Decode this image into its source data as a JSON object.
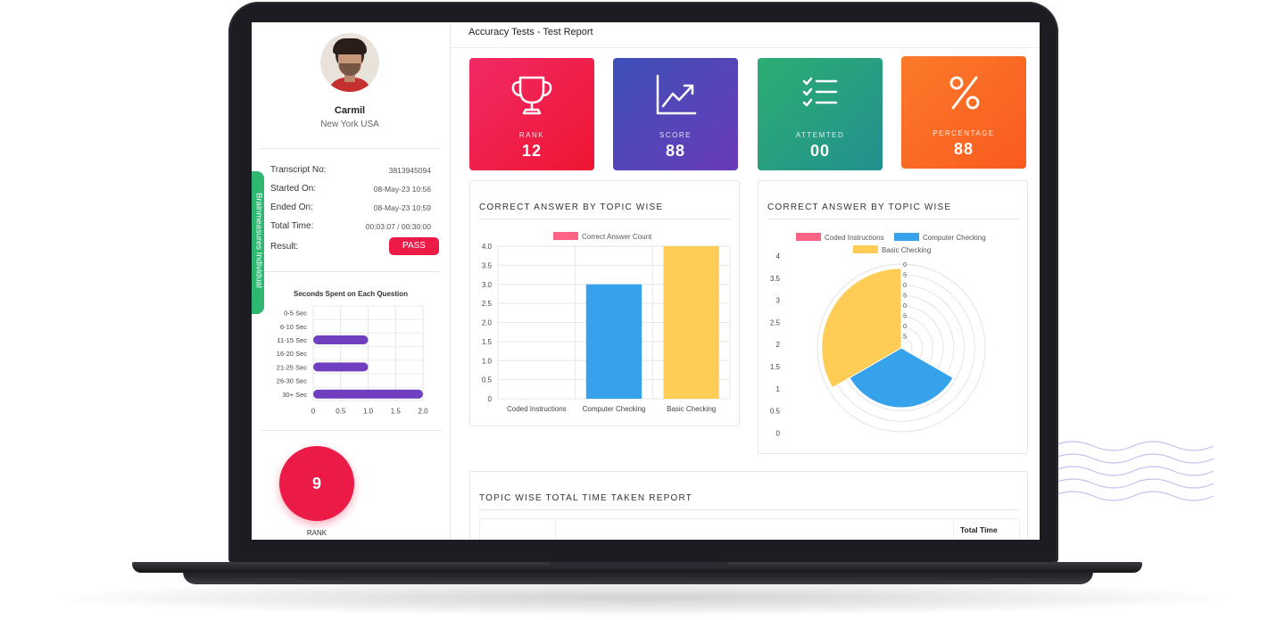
{
  "app": {
    "page_title": "Accuracy Tests - Test Report",
    "side_tab_label": "Brainmeasures Individual"
  },
  "user": {
    "name": "Carmil",
    "location": "New York  USA"
  },
  "transcript": {
    "rows": [
      {
        "label": "Transcript No:",
        "value": "3813945094"
      },
      {
        "label": "Started On:",
        "value": "08-May-23 10:56"
      },
      {
        "label": "Ended On:",
        "value": "08-May-23 10:59"
      },
      {
        "label": "Total Time:",
        "value": "00:03:07 / 00:30:00"
      }
    ],
    "result_label": "Result:",
    "result_value": "PASS"
  },
  "stats": [
    {
      "label": "RANK",
      "value": "12",
      "icon": "trophy-icon",
      "color_from": "#f02a66",
      "color_to": "#ef1531"
    },
    {
      "label": "SCORE",
      "value": "88",
      "icon": "chart-line-icon",
      "color_from": "#3d4fb8",
      "color_to": "#6a3bb8"
    },
    {
      "label": "ATTEMTED",
      "value": "00",
      "icon": "checklist-icon",
      "color_from": "#2cae72",
      "color_to": "#22908f"
    },
    {
      "label": "PERCENTAGE",
      "value": "88",
      "icon": "percent-icon",
      "color_from": "#fb7a2a",
      "color_to": "#fa5b1f"
    }
  ],
  "rank_badge": {
    "value": "9",
    "label": "RANK"
  },
  "panels": {
    "bar_title": "CORRECT ANSWER BY TOPIC WISE",
    "polar_title": "CORRECT ANSWER BY TOPIC WISE",
    "time_title": "TOPIC WISE TOTAL TIME TAKEN REPORT",
    "time_col_total": "Total Time"
  },
  "colors": {
    "accent": "#ec1a46",
    "green": "#2eb872",
    "blue": "#36a2eb",
    "yellow": "#ffcd56",
    "pink": "#ff6384",
    "purple": "#6f3fc0"
  },
  "chart_data": [
    {
      "type": "bar",
      "orientation": "horizontal",
      "title": "Seconds Spent on Each Question",
      "categories": [
        "0-5 Sec",
        "6-10 Sec",
        "11-15 Sec",
        "16-20 Sec",
        "21-25 Sec",
        "26-30 Sec",
        "30+ Sec"
      ],
      "values": [
        0,
        0,
        1,
        0,
        1,
        0,
        2
      ],
      "xlim": [
        0,
        2
      ],
      "xticks": [
        "0",
        "0.5",
        "1.0",
        "1.5",
        "2.0"
      ],
      "color": "#6f3fc0",
      "grid": true
    },
    {
      "type": "bar",
      "title": "",
      "categories": [
        "Coded Instructions",
        "Computer Checking",
        "Basic Checking"
      ],
      "series": [
        {
          "name": "Correct Answer Count",
          "values": [
            0,
            3,
            4
          ]
        }
      ],
      "bar_colors": [
        "#ff6384",
        "#36a2eb",
        "#ffcd56"
      ],
      "ylim": [
        0,
        4
      ],
      "yticks": [
        "4.0",
        "3.5",
        "3.0",
        "2.5",
        "2.0",
        "1.5",
        "1.0",
        "0.5",
        "0"
      ],
      "legend": "top",
      "grid": true
    },
    {
      "type": "pie",
      "variant": "polarArea",
      "title": "",
      "categories": [
        "Coded Instructions",
        "Computer Checking",
        "Basic Checking"
      ],
      "values": [
        0,
        3,
        4
      ],
      "colors": [
        "#ff6384",
        "#36a2eb",
        "#ffcd56"
      ],
      "rlim": [
        0,
        4
      ],
      "axis_ticks": [
        "4",
        "3.5",
        "3",
        "2.5",
        "2",
        "1.5",
        "1",
        "0.5",
        "0"
      ],
      "ring_labels": [
        "0",
        "5",
        "0",
        "5",
        "0",
        "5",
        "0",
        "5"
      ],
      "legend": "top"
    }
  ]
}
